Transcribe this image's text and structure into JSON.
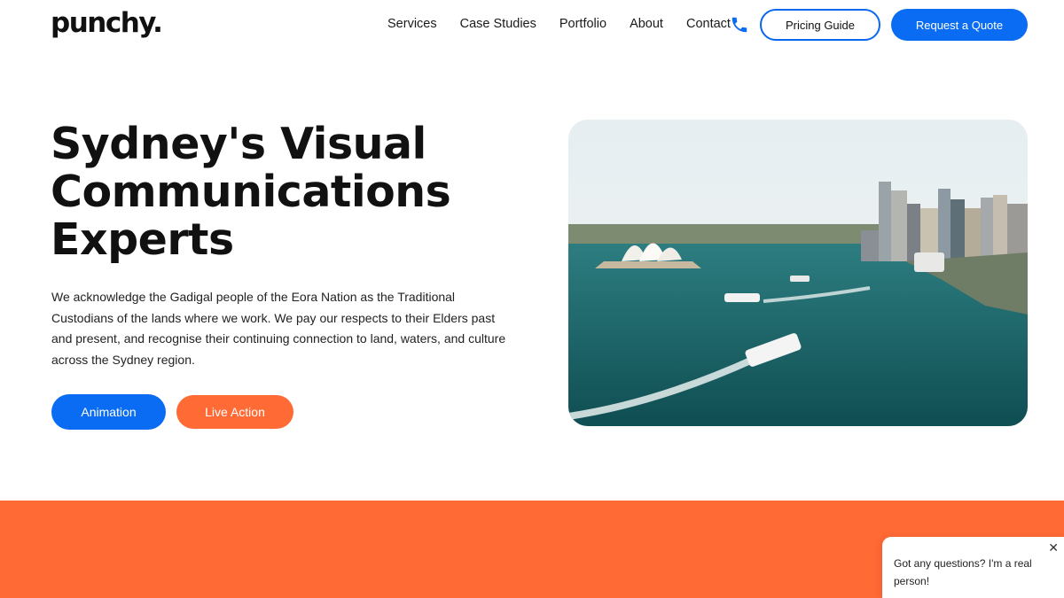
{
  "header": {
    "logo": "punchy.",
    "nav": [
      "Services",
      "Case Studies",
      "Portfolio",
      "About",
      "Contact"
    ],
    "pricing_label": "Pricing Guide",
    "quote_label": "Request a Quote"
  },
  "hero": {
    "title_lines": [
      "Sydney's Visual",
      "Communications",
      "Experts"
    ],
    "acknowledgement": "We acknowledge the Gadigal people of the Eora Nation as the Traditional Custodians of the lands where we work. We pay our respects to their Elders past and present, and recognise their continuing connection to land, waters, and culture across the Sydney region.",
    "animation_label": "Animation",
    "live_action_label": "Live Action"
  },
  "chat": {
    "message": "Got any questions? I'm a real person!",
    "close_glyph": "✕"
  },
  "colors": {
    "blue": "#0a6cf2",
    "orange": "#ff6a35"
  }
}
